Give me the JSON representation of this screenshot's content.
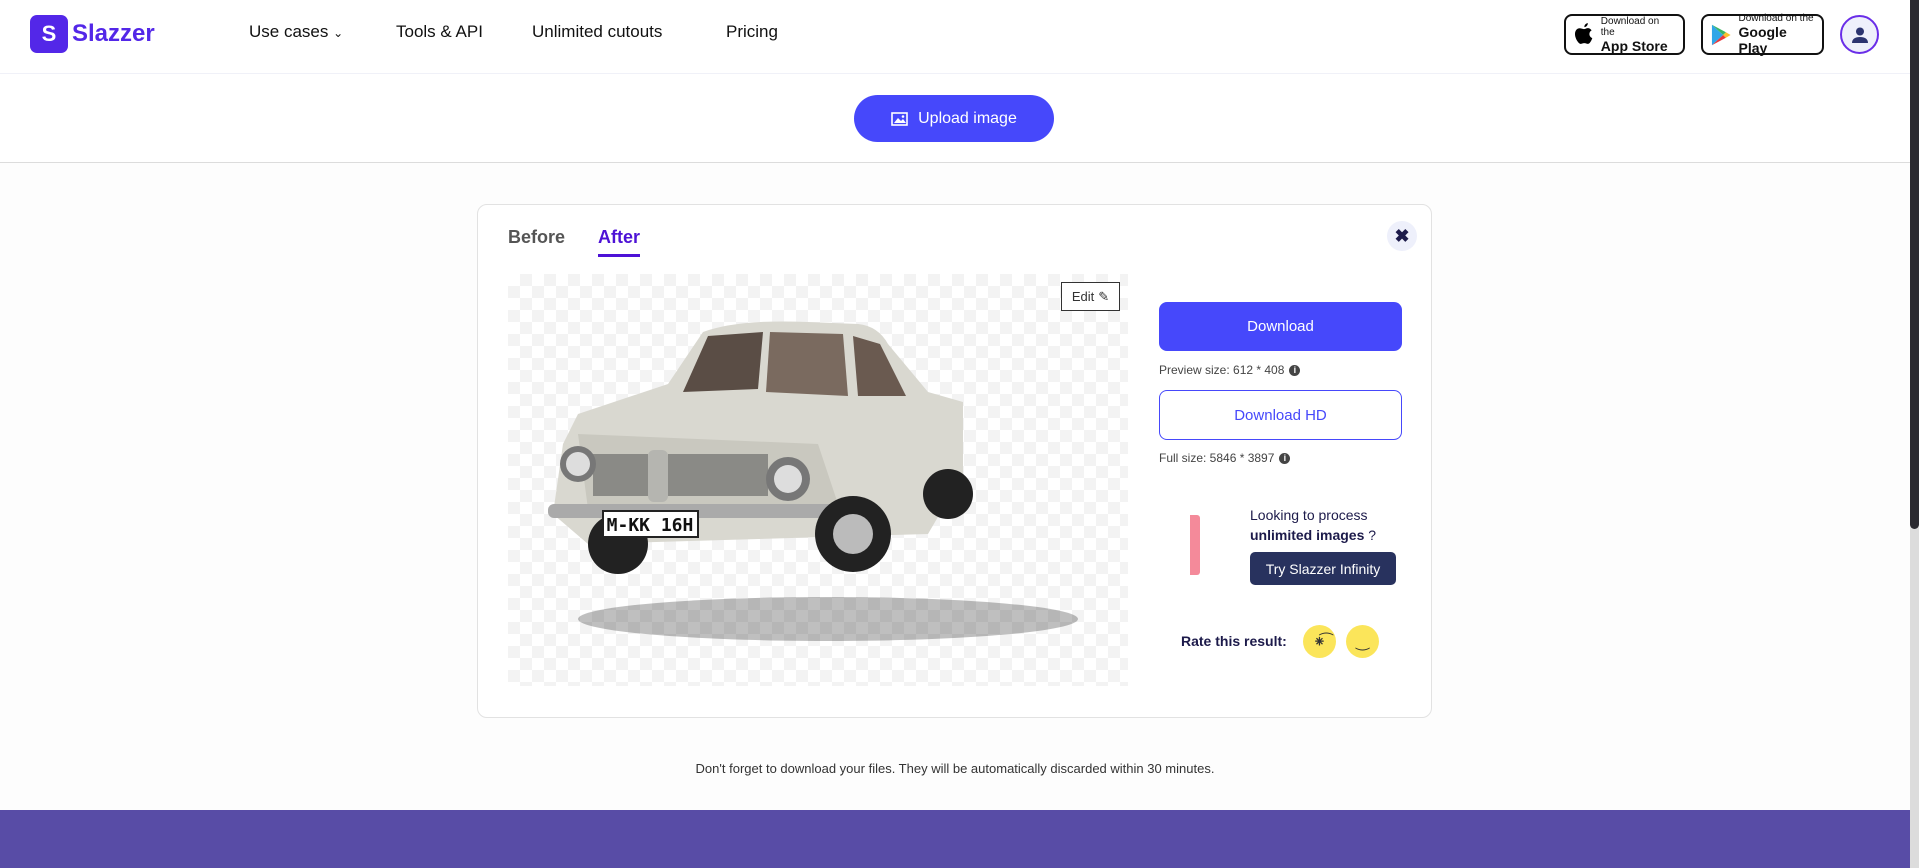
{
  "header": {
    "logo_text": "Slazzer",
    "nav": [
      {
        "label": "Use cases",
        "has_dropdown": true
      },
      {
        "label": "Tools & API"
      },
      {
        "label": "Unlimited cutouts"
      },
      {
        "label": "Pricing"
      }
    ],
    "app_store": {
      "small": "Download on the",
      "big": "App Store"
    },
    "google_play": {
      "small": "Download on the",
      "big": "Google Play"
    }
  },
  "upload": {
    "label": "Upload image",
    "icon": "image-icon"
  },
  "card": {
    "tabs": [
      {
        "label": "Before",
        "active": false
      },
      {
        "label": "After",
        "active": true
      }
    ],
    "edit_label": "Edit",
    "license_plate": "M-KK 16H",
    "download_label": "Download",
    "preview_size": "Preview size: 612 * 408",
    "download_hd_label": "Download HD",
    "full_size": "Full size: 5846 * 3897",
    "promo": {
      "line1": "Looking to process",
      "bold": "unlimited images",
      "suffix": " ?",
      "button": "Try Slazzer Infinity"
    },
    "rate_label": "Rate this result:"
  },
  "note": "Don't forget to download your files. They will be automatically discarded within 30 minutes.",
  "colors": {
    "accent": "#4648fb",
    "brand": "#5327e8",
    "footer": "#584ca6",
    "dark_button": "#28325e"
  }
}
